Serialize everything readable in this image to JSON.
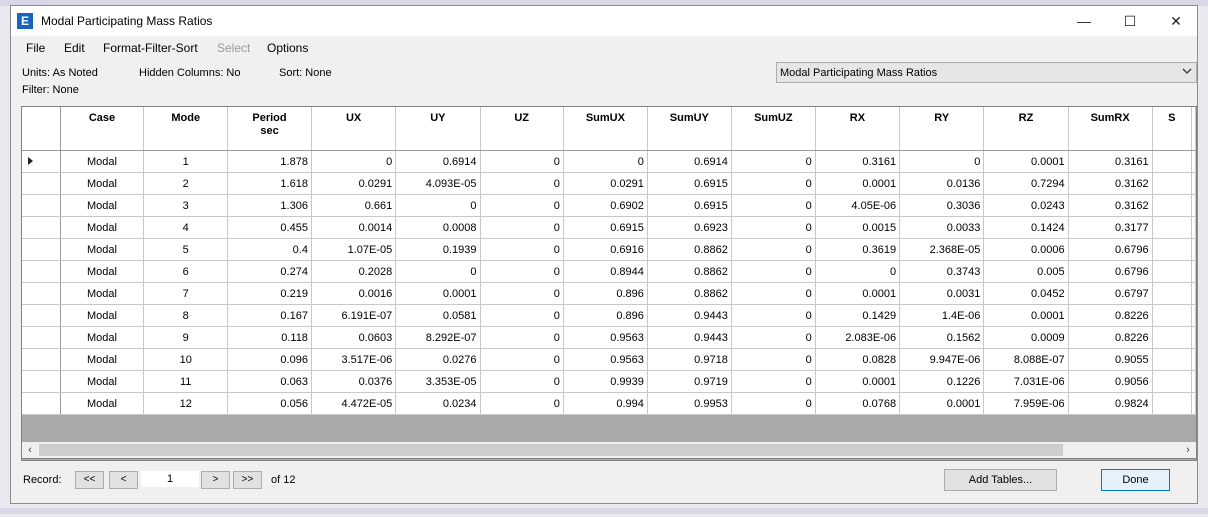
{
  "window": {
    "title": "Modal Participating Mass Ratios",
    "app_icon": "E"
  },
  "menu": {
    "file": "File",
    "edit": "Edit",
    "format": "Format-Filter-Sort",
    "select": "Select",
    "options": "Options"
  },
  "info": {
    "units": "Units:  As Noted",
    "hidden": "Hidden Columns:  No",
    "sort": "Sort:  None",
    "filter": "Filter:  None"
  },
  "table_selector": {
    "value": "Modal Participating Mass Ratios"
  },
  "table": {
    "columns": [
      "Case",
      "Mode",
      "Period\nsec",
      "UX",
      "UY",
      "UZ",
      "SumUX",
      "SumUY",
      "SumUZ",
      "RX",
      "RY",
      "RZ",
      "SumRX",
      "S"
    ],
    "rows": [
      [
        "Modal",
        "1",
        "1.878",
        "0",
        "0.6914",
        "0",
        "0",
        "0.6914",
        "0",
        "0.3161",
        "0",
        "0.0001",
        "0.3161",
        ""
      ],
      [
        "Modal",
        "2",
        "1.618",
        "0.0291",
        "4.093E-05",
        "0",
        "0.0291",
        "0.6915",
        "0",
        "0.0001",
        "0.0136",
        "0.7294",
        "0.3162",
        ""
      ],
      [
        "Modal",
        "3",
        "1.306",
        "0.661",
        "0",
        "0",
        "0.6902",
        "0.6915",
        "0",
        "4.05E-06",
        "0.3036",
        "0.0243",
        "0.3162",
        ""
      ],
      [
        "Modal",
        "4",
        "0.455",
        "0.0014",
        "0.0008",
        "0",
        "0.6915",
        "0.6923",
        "0",
        "0.0015",
        "0.0033",
        "0.1424",
        "0.3177",
        ""
      ],
      [
        "Modal",
        "5",
        "0.4",
        "1.07E-05",
        "0.1939",
        "0",
        "0.6916",
        "0.8862",
        "0",
        "0.3619",
        "2.368E-05",
        "0.0006",
        "0.6796",
        ""
      ],
      [
        "Modal",
        "6",
        "0.274",
        "0.2028",
        "0",
        "0",
        "0.8944",
        "0.8862",
        "0",
        "0",
        "0.3743",
        "0.005",
        "0.6796",
        ""
      ],
      [
        "Modal",
        "7",
        "0.219",
        "0.0016",
        "0.0001",
        "0",
        "0.896",
        "0.8862",
        "0",
        "0.0001",
        "0.0031",
        "0.0452",
        "0.6797",
        ""
      ],
      [
        "Modal",
        "8",
        "0.167",
        "6.191E-07",
        "0.0581",
        "0",
        "0.896",
        "0.9443",
        "0",
        "0.1429",
        "1.4E-06",
        "0.0001",
        "0.8226",
        ""
      ],
      [
        "Modal",
        "9",
        "0.118",
        "0.0603",
        "8.292E-07",
        "0",
        "0.9563",
        "0.9443",
        "0",
        "2.083E-06",
        "0.1562",
        "0.0009",
        "0.8226",
        ""
      ],
      [
        "Modal",
        "10",
        "0.096",
        "3.517E-06",
        "0.0276",
        "0",
        "0.9563",
        "0.9718",
        "0",
        "0.0828",
        "9.947E-06",
        "8.088E-07",
        "0.9055",
        ""
      ],
      [
        "Modal",
        "11",
        "0.063",
        "0.0376",
        "3.353E-05",
        "0",
        "0.9939",
        "0.9719",
        "0",
        "0.0001",
        "0.1226",
        "7.031E-06",
        "0.9056",
        ""
      ],
      [
        "Modal",
        "12",
        "0.056",
        "4.472E-05",
        "0.0234",
        "0",
        "0.994",
        "0.9953",
        "0",
        "0.0768",
        "0.0001",
        "7.959E-06",
        "0.9824",
        ""
      ]
    ]
  },
  "footer": {
    "record_label": "Record:",
    "first": "<<",
    "prev": "<",
    "next": ">",
    "last": ">>",
    "record_value": "1",
    "of_text": "of 12",
    "add_tables": "Add Tables...",
    "done": "Done"
  }
}
